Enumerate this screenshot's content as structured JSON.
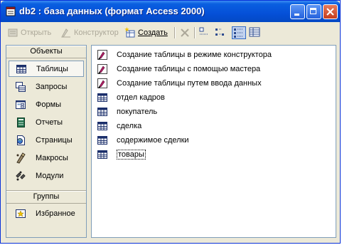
{
  "window": {
    "title": "db2 : база данных (формат Access 2000)",
    "controls": {
      "minimize": "minimize",
      "maximize": "maximize",
      "close": "close"
    }
  },
  "toolbar": {
    "open_label": "Открыть",
    "design_label": "Конструктор",
    "create_label": "Создать",
    "delete_icon": "delete-icon",
    "views": [
      "large-icons",
      "small-icons",
      "list",
      "details"
    ],
    "active_view": "list"
  },
  "objects_panel": {
    "header": "Объекты",
    "items": [
      {
        "label": "Таблицы",
        "icon": "table-icon",
        "selected": true
      },
      {
        "label": "Запросы",
        "icon": "query-icon",
        "selected": false
      },
      {
        "label": "Формы",
        "icon": "form-icon",
        "selected": false
      },
      {
        "label": "Отчеты",
        "icon": "report-icon",
        "selected": false
      },
      {
        "label": "Страницы",
        "icon": "page-icon",
        "selected": false
      },
      {
        "label": "Макросы",
        "icon": "macro-icon",
        "selected": false
      },
      {
        "label": "Модули",
        "icon": "module-icon",
        "selected": false
      }
    ],
    "groups_header": "Группы",
    "groups": [
      {
        "label": "Избранное",
        "icon": "favorites-icon"
      }
    ]
  },
  "list": {
    "items": [
      {
        "label": "Создание таблицы в режиме конструктора",
        "icon": "wizard-shortcut-icon"
      },
      {
        "label": "Создание таблицы с помощью мастера",
        "icon": "wizard-shortcut-icon"
      },
      {
        "label": "Создание таблицы путем ввода данных",
        "icon": "wizard-shortcut-icon"
      },
      {
        "label": "отдел кадров",
        "icon": "table-icon"
      },
      {
        "label": "покупатель",
        "icon": "table-icon"
      },
      {
        "label": "сделка",
        "icon": "table-icon"
      },
      {
        "label": "содержимое сделки",
        "icon": "table-icon"
      },
      {
        "label": "товары",
        "icon": "table-icon",
        "focused": true
      }
    ]
  },
  "colors": {
    "titlebar": "#0550d8",
    "selection_border": "#316ac5",
    "pane_border": "#7f9db9",
    "disabled_text": "#aca899"
  }
}
